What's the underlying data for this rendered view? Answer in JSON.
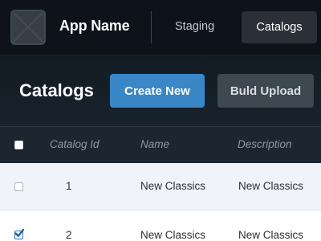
{
  "nav": {
    "app_name": "App Name",
    "items": [
      "Staging",
      "Catalogs"
    ],
    "active": "Catalogs"
  },
  "header": {
    "title": "Catalogs",
    "create_label": "Create New",
    "bulk_label": "Buld Upload"
  },
  "table": {
    "columns": [
      "Catalog Id",
      "Name",
      "Description"
    ],
    "rows": [
      {
        "id": "1",
        "name": "New Classics",
        "description": "New Classics",
        "checked": false
      },
      {
        "id": "2",
        "name": "New Classics",
        "description": "New Classics",
        "checked": true
      }
    ]
  },
  "colors": {
    "primary": "#3a87c8",
    "nav_background": "#0d1319",
    "header_background": "#18222c"
  },
  "icons": {
    "logo": "image-placeholder-icon",
    "checkbox_checked": "checkmark-icon"
  }
}
